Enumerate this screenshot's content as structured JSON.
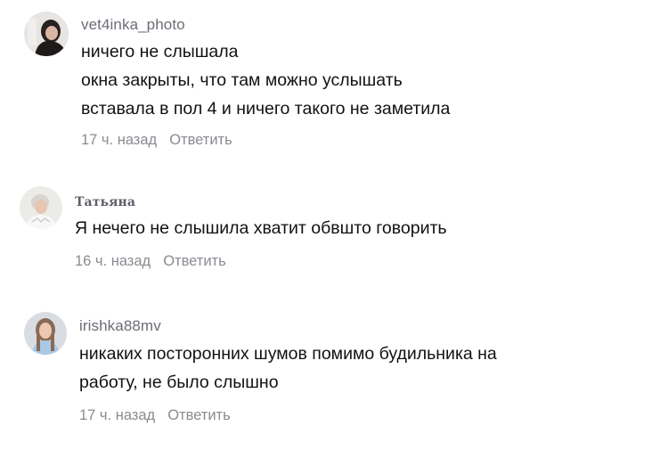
{
  "comments": [
    {
      "username": "vet4inka_photo",
      "lines": [
        "ничего не слышала",
        "окна закрыты, что там можно услышать",
        "вставала в пол 4 и ничего такого не заметила"
      ],
      "time": "17 ч. назад",
      "reply_label": "Ответить"
    },
    {
      "username": "Татьяна",
      "lines": [
        "Я нечего не слышила хватит обвшто говорить"
      ],
      "time": "16 ч. назад",
      "reply_label": "Ответить"
    },
    {
      "username": "irishka88mv",
      "lines": [
        "никаких посторонних шумов помимо будильника на",
        "работу, не было слышно"
      ],
      "time": "17 ч. назад",
      "reply_label": "Ответить"
    }
  ]
}
